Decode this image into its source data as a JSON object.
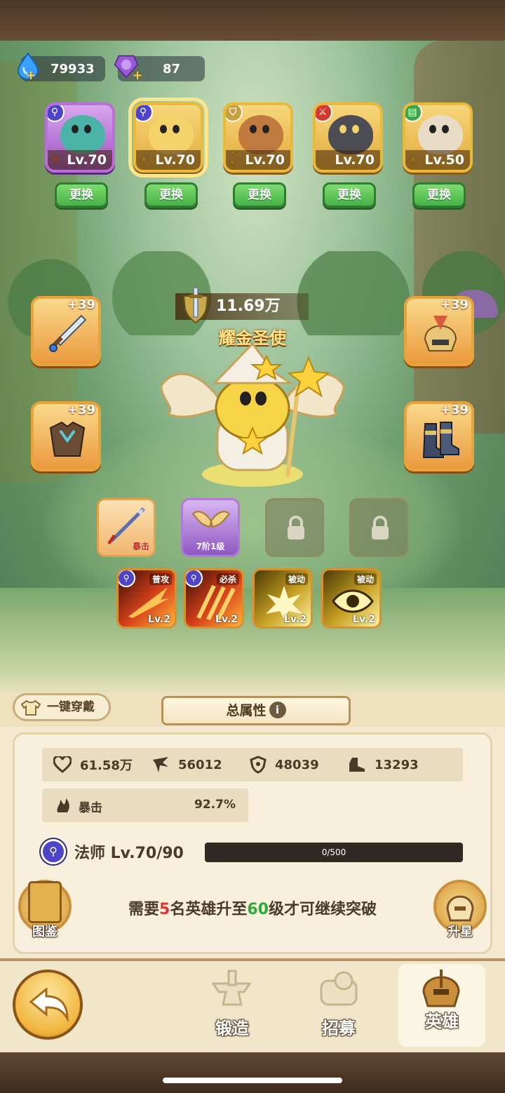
{
  "currency": {
    "water": {
      "icon": "water-drop-icon",
      "value": "79933"
    },
    "gem": {
      "icon": "purple-gem-icon",
      "value": "87"
    }
  },
  "heroes": [
    {
      "level": "Lv.70",
      "class_icon": "staff-icon",
      "frame": "purple",
      "swap_label": "更换",
      "selected": false
    },
    {
      "level": "Lv.70",
      "class_icon": "staff-icon",
      "frame": "gold",
      "swap_label": "更换",
      "selected": true
    },
    {
      "level": "Lv.70",
      "class_icon": "shield-icon",
      "frame": "gold",
      "swap_label": "更换",
      "selected": false
    },
    {
      "level": "Lv.70",
      "class_icon": "sword-icon",
      "frame": "gold",
      "swap_label": "更换",
      "selected": false
    },
    {
      "level": "Lv.50",
      "class_icon": "book-icon",
      "frame": "gold",
      "swap_label": "更换",
      "selected": false
    }
  ],
  "hero": {
    "power": "11.69万",
    "name": "耀金圣使"
  },
  "equipment": {
    "weapon": {
      "plus": "+39",
      "icon": "sword-icon"
    },
    "helmet": {
      "plus": "+39",
      "icon": "helmet-icon"
    },
    "armor": {
      "plus": "+39",
      "icon": "armor-icon"
    },
    "boots": {
      "plus": "+39",
      "icon": "boots-icon"
    }
  },
  "gear": {
    "artifact_label": "暴击",
    "wings_label": "7阶1级"
  },
  "skills": [
    {
      "tag": "普攻",
      "level": "Lv.2",
      "style": "red",
      "icon": "fire-slash-icon"
    },
    {
      "tag": "必杀",
      "level": "Lv.2",
      "style": "red",
      "icon": "fire-claw-icon"
    },
    {
      "tag": "被动",
      "level": "Lv.2",
      "style": "gold",
      "icon": "burst-icon"
    },
    {
      "tag": "被动",
      "level": "Lv.2",
      "style": "gold",
      "icon": "eye-icon"
    }
  ],
  "panel": {
    "one_key_label": "一键穿戴",
    "attr_tab_label": "总属性",
    "stats": {
      "hp": "61.58万",
      "attack": "56012",
      "defense": "48039",
      "speed": "13293"
    },
    "crit_label": "暴击",
    "crit_value": "92.7%",
    "class_label": "法师 Lv.70/90",
    "xp_text": "0/500",
    "notice": {
      "p1": "需要",
      "n1": "5",
      "p2": "名英雄升至",
      "n2": "60",
      "p3": "级才可继续突破"
    },
    "codex_label": "图鉴",
    "star_up_label": "升星"
  },
  "nav": {
    "forge": "锻造",
    "recruit": "招募",
    "heroes": "英雄"
  }
}
